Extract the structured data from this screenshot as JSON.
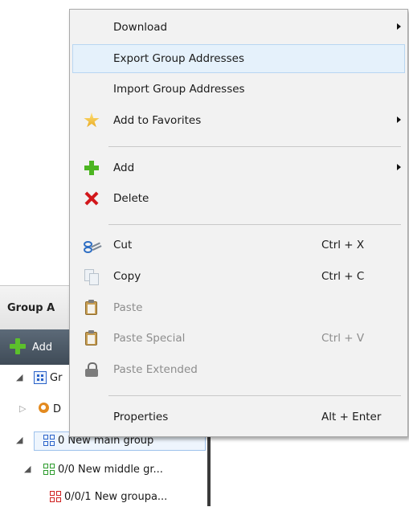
{
  "panel": {
    "title": "Group A",
    "toolbar_label": "Add",
    "tree": [
      {
        "label": "Gr"
      },
      {
        "label": "D"
      },
      {
        "label": "0 New main group"
      },
      {
        "label": "0/0 New middle gr..."
      },
      {
        "label": "0/0/1 New groupa..."
      }
    ]
  },
  "menu": {
    "items": [
      {
        "label": "Download",
        "shortcut": "",
        "submenu": true
      },
      {
        "label": "Export Group Addresses",
        "shortcut": ""
      },
      {
        "label": "Import Group Addresses",
        "shortcut": ""
      },
      {
        "label": "Add to Favorites",
        "shortcut": "",
        "icon": "star-icon",
        "submenu": true
      },
      {
        "label": "Add",
        "shortcut": "",
        "icon": "plus-icon",
        "submenu": true
      },
      {
        "label": "Delete",
        "shortcut": "",
        "icon": "delete-x-icon"
      },
      {
        "label": "Cut",
        "shortcut": "Ctrl + X",
        "icon": "scissors-icon"
      },
      {
        "label": "Copy",
        "shortcut": "Ctrl + C",
        "icon": "copy-icon"
      },
      {
        "label": "Paste",
        "shortcut": "",
        "icon": "clipboard-icon",
        "disabled": true
      },
      {
        "label": "Paste Special",
        "shortcut": "Ctrl + V",
        "icon": "clipboard-icon",
        "disabled": true
      },
      {
        "label": "Paste Extended",
        "shortcut": "",
        "icon": "lock-icon",
        "disabled": true
      },
      {
        "label": "Properties",
        "shortcut": "Alt + Enter"
      }
    ]
  },
  "colors": {
    "menu_bg": "#f2f2f2",
    "hover_bg": "#e5f1fb",
    "toolbar_bg": "#4b5865",
    "disabled_text": "#8d8d8d"
  }
}
